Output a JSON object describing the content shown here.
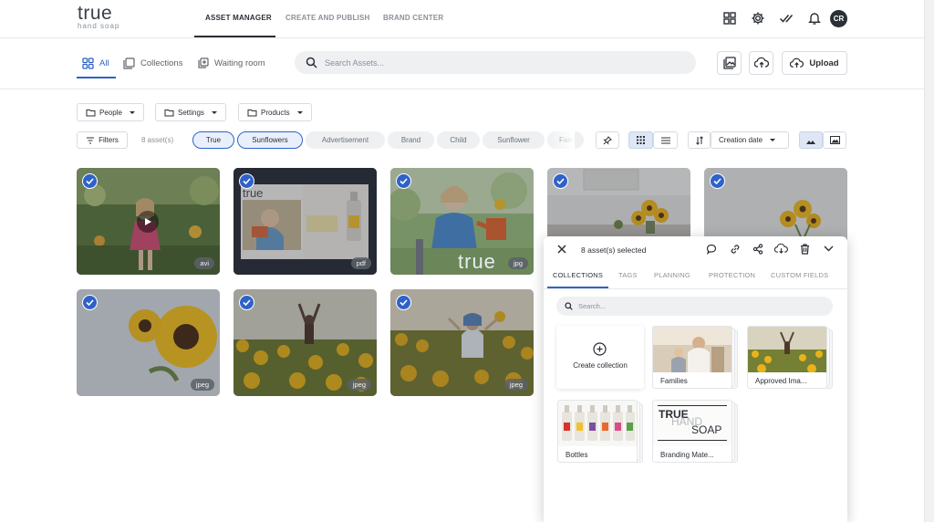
{
  "brand": {
    "name": "true",
    "tagline": "hand soap"
  },
  "topnav": {
    "tabs": [
      {
        "label": "ASSET MANAGER",
        "active": true
      },
      {
        "label": "CREATE AND PUBLISH",
        "active": false
      },
      {
        "label": "BRAND CENTER",
        "active": false
      }
    ],
    "icons": [
      "apps-icon",
      "gear-icon",
      "double-check-icon",
      "bell-icon"
    ],
    "avatar_initials": "CR"
  },
  "subbar": {
    "tabs": [
      {
        "label": "All",
        "active": true,
        "icon": "grid-icon"
      },
      {
        "label": "Collections",
        "active": false,
        "icon": "collection-icon"
      },
      {
        "label": "Waiting room",
        "active": false,
        "icon": "waiting-room-icon"
      }
    ],
    "search_placeholder": "Search Assets...",
    "upload_label": "Upload"
  },
  "filters": {
    "dropdowns": [
      "People",
      "Settings",
      "Products"
    ],
    "filters_label": "Filters",
    "asset_count": "8 asset(s)",
    "chips": [
      {
        "label": "True",
        "selected": true
      },
      {
        "label": "Sunflowers",
        "selected": true
      },
      {
        "label": "Advertisement",
        "selected": false
      },
      {
        "label": "Brand",
        "selected": false
      },
      {
        "label": "Child",
        "selected": false
      },
      {
        "label": "Sunflower",
        "selected": false
      },
      {
        "label": "Fam",
        "selected": false
      }
    ],
    "sort_label": "Creation date"
  },
  "assets": [
    {
      "ext": "avi",
      "selected": true,
      "scene": "girl-garden"
    },
    {
      "ext": "pdf",
      "selected": true,
      "scene": "brochure"
    },
    {
      "ext": "jpg",
      "selected": true,
      "scene": "child-watering"
    },
    {
      "ext": "",
      "selected": true,
      "scene": "kitchen-sunflowers"
    },
    {
      "ext": "",
      "selected": true,
      "scene": "vase-sunflowers"
    },
    {
      "ext": "jpeg",
      "selected": true,
      "scene": "sunflower-closeup"
    },
    {
      "ext": "jpeg",
      "selected": true,
      "scene": "woman-field"
    },
    {
      "ext": "jpeg",
      "selected": true,
      "scene": "father-child-field"
    }
  ],
  "panel": {
    "title": "8 asset(s) selected",
    "tabs": [
      {
        "label": "COLLECTIONS",
        "active": true
      },
      {
        "label": "TAGS",
        "active": false
      },
      {
        "label": "PLANNING",
        "active": false
      },
      {
        "label": "PROTECTION",
        "active": false
      },
      {
        "label": "CUSTOM FIELDS",
        "active": false
      }
    ],
    "search_placeholder": "Search...",
    "create_label": "Create collection",
    "collections": [
      "Families",
      "Approved Ima...",
      "Bottles",
      "Branding Mate..."
    ],
    "branding_text": [
      "TRUE",
      "HAND",
      "SOAP"
    ]
  },
  "colors": {
    "accent": "#2f62c9",
    "text": "#2b2f36",
    "muted": "#8b9098"
  }
}
